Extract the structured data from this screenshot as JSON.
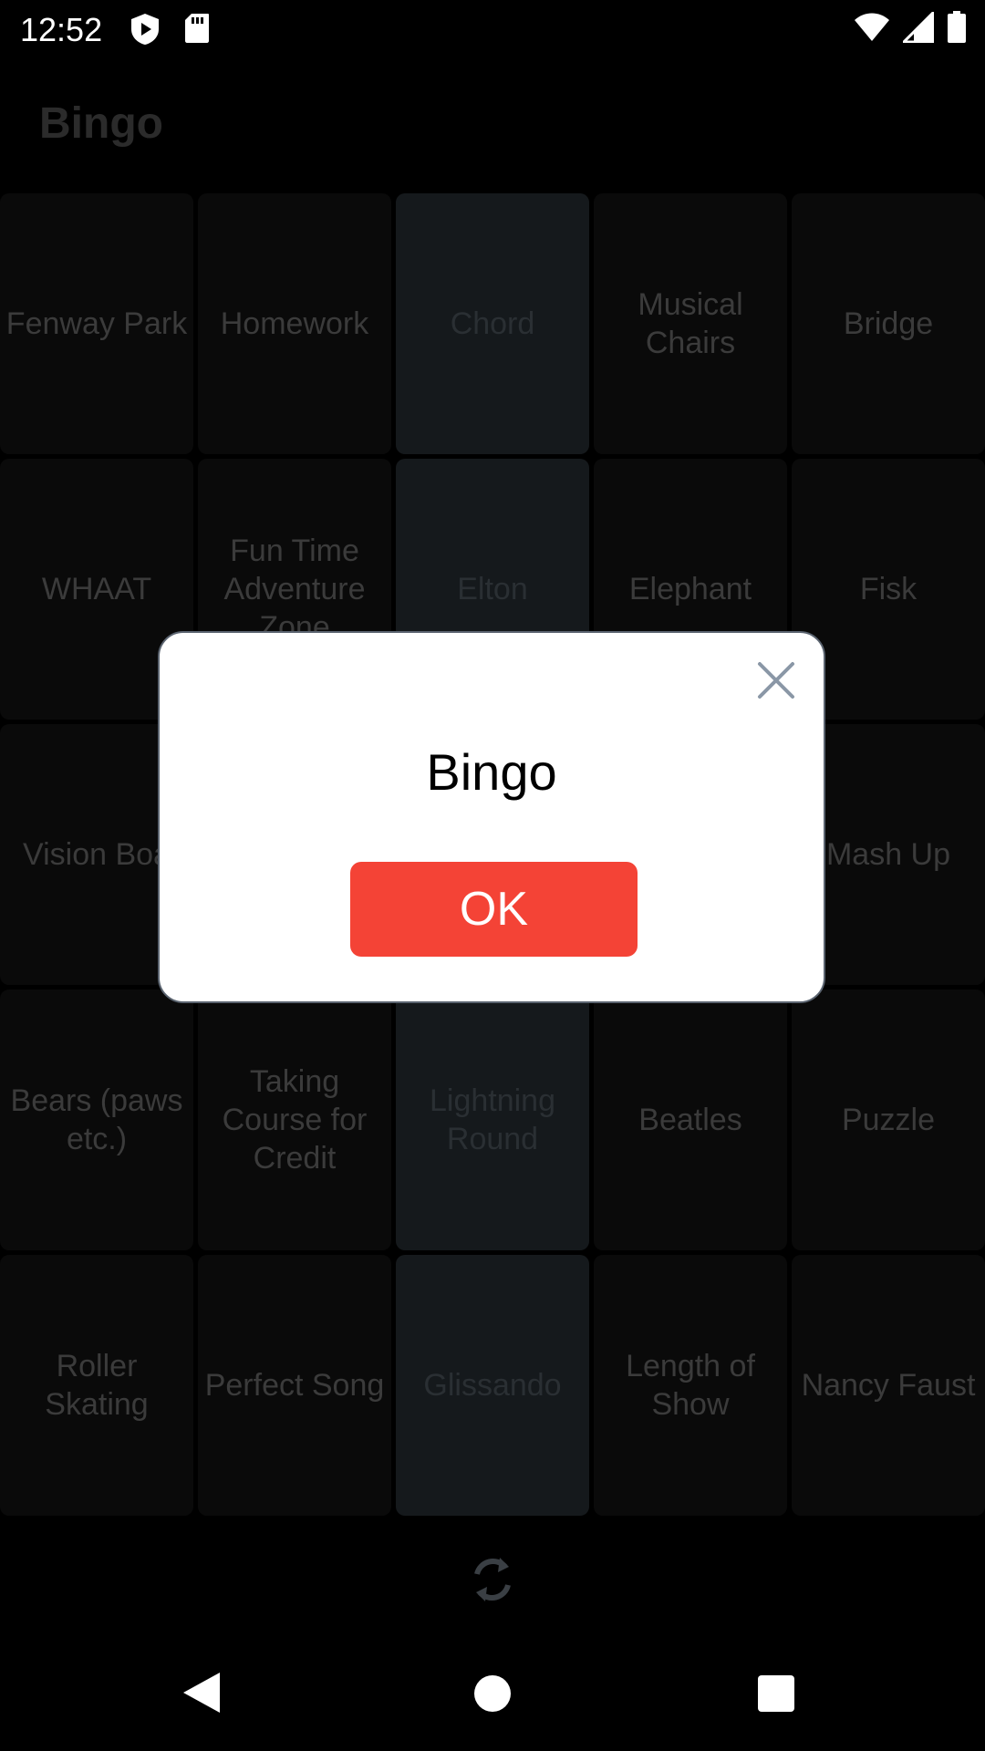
{
  "status_bar": {
    "time": "12:52",
    "left_icons": [
      "play-protect-icon",
      "sd-card-icon"
    ],
    "right_icons": [
      "wifi-icon",
      "cell-signal-icon",
      "battery-icon"
    ]
  },
  "app": {
    "title": "Bingo",
    "grid": [
      {
        "label": "Fenway Park",
        "marked": false
      },
      {
        "label": "Homework",
        "marked": false
      },
      {
        "label": "Chord",
        "marked": true
      },
      {
        "label": "Musical Chairs",
        "marked": false
      },
      {
        "label": "Bridge",
        "marked": false
      },
      {
        "label": "WHAAT",
        "marked": false
      },
      {
        "label": "Fun Time Adventure Zone",
        "marked": false
      },
      {
        "label": "Elton",
        "marked": true
      },
      {
        "label": "Elephant",
        "marked": false
      },
      {
        "label": "Fisk",
        "marked": false
      },
      {
        "label": "Vision Boa",
        "marked": false
      },
      {
        "label": "",
        "marked": false
      },
      {
        "label": "",
        "marked": true
      },
      {
        "label": "",
        "marked": false
      },
      {
        "label": "Mash Up",
        "marked": false
      },
      {
        "label": "Bears (paws etc.)",
        "marked": false
      },
      {
        "label": "Taking Course for Credit",
        "marked": false
      },
      {
        "label": "Lightning Round",
        "marked": true
      },
      {
        "label": "Beatles",
        "marked": false
      },
      {
        "label": "Puzzle",
        "marked": false
      },
      {
        "label": "Roller Skating",
        "marked": false
      },
      {
        "label": "Perfect Song",
        "marked": false
      },
      {
        "label": "Glissando",
        "marked": true
      },
      {
        "label": "Length of Show",
        "marked": false
      },
      {
        "label": "Nancy Faust",
        "marked": false
      }
    ],
    "refresh_icon": "refresh-icon"
  },
  "dialog": {
    "title": "Bingo",
    "ok_label": "OK",
    "close_icon": "close-icon"
  },
  "colors": {
    "ok_button": "#f44336",
    "dialog_background": "#ffffff",
    "app_background": "#000000"
  }
}
